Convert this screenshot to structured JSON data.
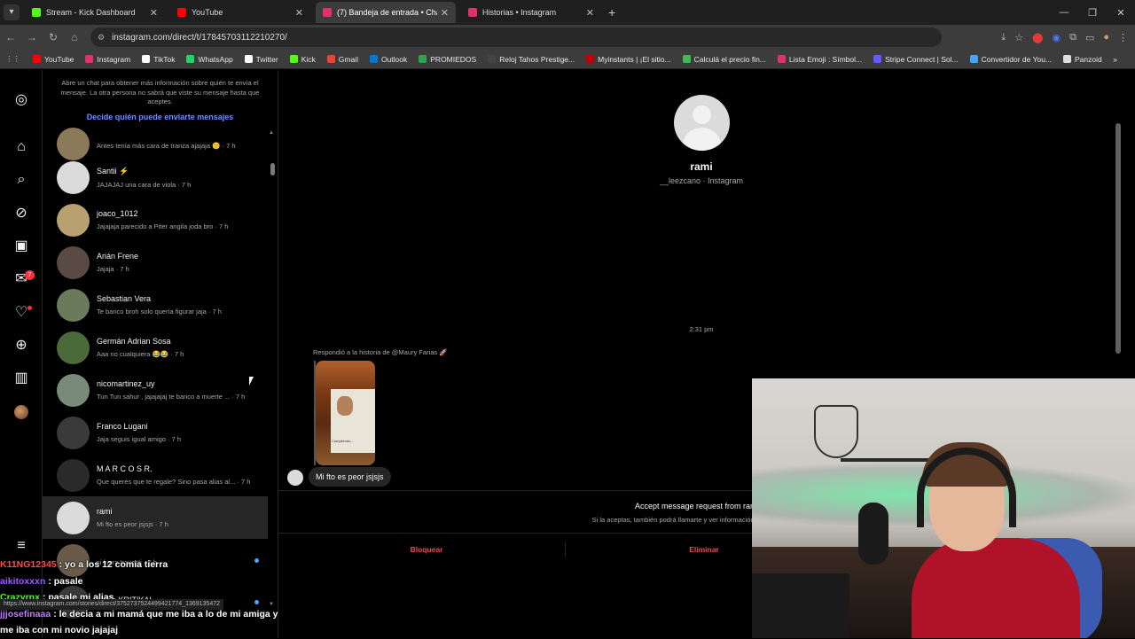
{
  "browser": {
    "tabs": [
      {
        "label": "Stream - Kick Dashboard",
        "color": "#53fc18",
        "active": false
      },
      {
        "label": "YouTube",
        "color": "#ff0000",
        "active": false
      },
      {
        "label": "(7) Bandeja de entrada • Chats",
        "color": "#e1306c",
        "active": true
      },
      {
        "label": "Historias • Instagram",
        "color": "#e1306c",
        "active": false
      }
    ],
    "url": "instagram.com/direct/t/17845703112210270/",
    "bookmarks": [
      {
        "label": "YouTube",
        "color": "#ff0000"
      },
      {
        "label": "Instagram",
        "color": "#e1306c"
      },
      {
        "label": "TikTok",
        "color": "#ffffff"
      },
      {
        "label": "WhatsApp",
        "color": "#25d366"
      },
      {
        "label": "Twitter",
        "color": "#ffffff"
      },
      {
        "label": "Kick",
        "color": "#53fc18"
      },
      {
        "label": "Gmail",
        "color": "#ea4335"
      },
      {
        "label": "Outlook",
        "color": "#0078d4"
      },
      {
        "label": "PROMIEDOS",
        "color": "#2ea44f"
      },
      {
        "label": "Reloj Tahos Prestige...",
        "color": "#444444"
      },
      {
        "label": "Myinstants | ¡El sitio...",
        "color": "#c00000"
      },
      {
        "label": "Calculá el precio fin...",
        "color": "#3fb950"
      },
      {
        "label": "Lista Emoji : Símbol...",
        "color": "#e1306c"
      },
      {
        "label": "Stripe Connect | Sol...",
        "color": "#635bff"
      },
      {
        "label": "Convertidor de You...",
        "color": "#4aa3ff"
      },
      {
        "label": "Panzoid",
        "color": "#dddddd"
      }
    ]
  },
  "rail": {
    "notif_count": "7"
  },
  "inbox": {
    "request_info": "Abre un chat para obtener más información sobre quién te envía el mensaje. La otra persona no sabrá que viste su mensaje hasta que aceptes.",
    "request_link": "Decide quién puede enviarte mensajes",
    "conversations": [
      {
        "name": "",
        "preview": "Antes tenía más cara de tranza ajajaja 🙂 · 7 h",
        "avatar": "#8a7a5a"
      },
      {
        "name": "Santii ⚡",
        "preview": "JAJAJAJ una cara de viola · 7 h",
        "avatar": "#dbdbdb"
      },
      {
        "name": "joaco_1012",
        "preview": "Jajajaja parecido a Piter angila joda bro · 7 h",
        "avatar": "#b8a070"
      },
      {
        "name": "Arián Frene",
        "preview": "Jajaja · 7 h",
        "avatar": "#5a4a44"
      },
      {
        "name": "Sebastian Vera",
        "preview": "Te banco broh solo quería figurar jaja · 7 h",
        "avatar": "#6a7a5a"
      },
      {
        "name": "Germán Adrian Sosa",
        "preview": "Aaa no cualquiera 😂😂 · 7 h",
        "avatar": "#4a6a3a"
      },
      {
        "name": "nicomartinez_uy",
        "preview": "Tun Tun sahur , jajajajaj te banco a muerte ... · 7 h",
        "avatar": "#7a8a7a"
      },
      {
        "name": "Franco Lugani",
        "preview": "Jaja seguis igual amigo · 7 h",
        "avatar": "#3a3a3a"
      },
      {
        "name": "M A R C O S  R.",
        "preview": "Que querés que te regale? Sino pasa alias al... · 7 h",
        "avatar": "#2a2a2a"
      },
      {
        "name": "rami",
        "preview": "Mi fto es peor jsjsjs · 7 h",
        "avatar": "#dbdbdb",
        "active": true
      },
      {
        "name": "",
        "preview": "si fuera travesti · 7 h",
        "avatar": "#6a5a4a",
        "unread": true
      },
      {
        "name": "benja KRITIKAL",
        "preview": "",
        "avatar": "#3a3a3a",
        "unread": true
      }
    ]
  },
  "thread": {
    "name": "rami",
    "subtitle": "__leezcano · Instagram",
    "time": "2:31 pm",
    "story_reply": "Respondió a la historia de @Maury Farias 🚀",
    "story_caption": "Cumpliendo...",
    "message": "Mi fto es peor jsjsjs",
    "accept_title": "Accept message request from rami (_",
    "accept_sub": "Si la aceptas, también podrá llamarte y ver información como tu estado de",
    "block_label": "Bloquear",
    "delete_label": "Eliminar"
  },
  "stream_chat": [
    {
      "user": "K11NG12345",
      "color": "#ff4a4a",
      "msg": ": yo a los 12 comia tierra"
    },
    {
      "user": "aikitoxxxn",
      "color": "#9b5cff",
      "msg": ": pasale"
    },
    {
      "user": "Crazyrnx",
      "color": "#53fc18",
      "msg": ": pasale mi alias"
    },
    {
      "user": "jjjosefinaaa",
      "color": "#c07cff",
      "msg": ": le decia a mi mamá que me iba a lo de mi amiga y me iba con mi novio jajajaj"
    }
  ],
  "status_url": "https://www.instagram.com/stories/direct/3752737524499421774_1369135472"
}
